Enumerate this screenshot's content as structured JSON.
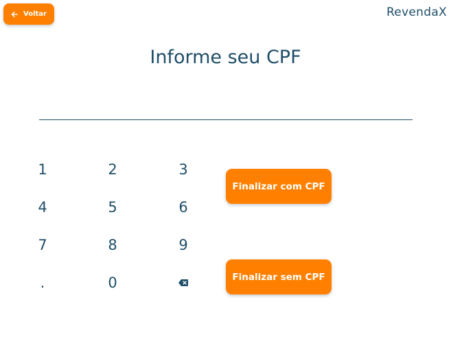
{
  "header": {
    "back_label": "Voltar",
    "back_icon": "arrow-left-icon",
    "brand": "RevendaX"
  },
  "main": {
    "title": "Informe seu CPF",
    "cpf_value": "",
    "keypad": {
      "keys": [
        "1",
        "2",
        "3",
        "4",
        "5",
        "6",
        "7",
        "8",
        "9",
        ".",
        "0"
      ],
      "backspace_icon": "backspace-icon"
    },
    "actions": {
      "with_cpf_label": "Finalizar com CPF",
      "without_cpf_label": "Finalizar sem CPF"
    }
  },
  "colors": {
    "accent": "#ff8000",
    "text": "#1f4e68",
    "background": "#ffffff"
  }
}
